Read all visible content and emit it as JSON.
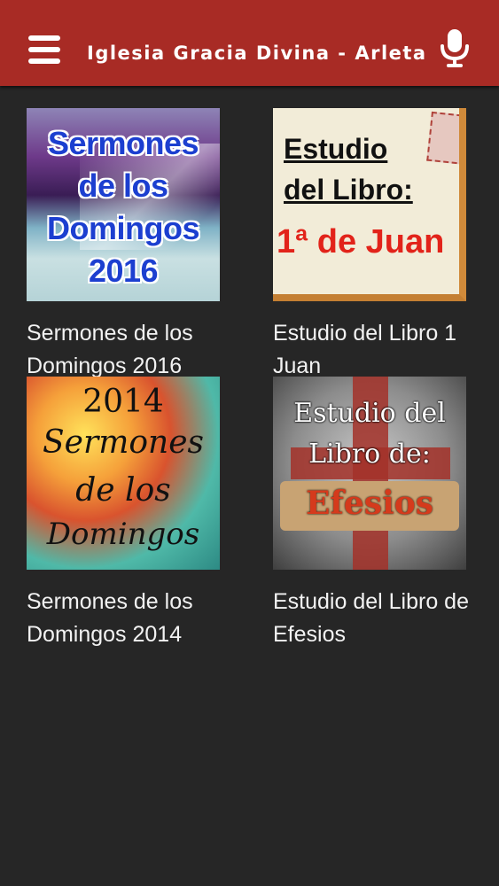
{
  "header": {
    "title": "Iglesia Gracia Divina - Arleta",
    "menu_icon": "hamburger-menu-icon",
    "mic_icon": "microphone-icon",
    "background_color": "#a82b25"
  },
  "items": [
    {
      "title": "Sermones de los Domingos 2016",
      "thumb_lines": [
        "Sermones",
        "de los",
        "Domingos",
        "2016"
      ]
    },
    {
      "title": "Estudio del Libro 1 Juan",
      "thumb_lines": [
        "Estudio",
        "del Libro:",
        "1ª de Juan"
      ]
    },
    {
      "title": "Sermones de los Domingos 2014",
      "thumb_lines": [
        "2014",
        "Sermones",
        "de los",
        "Domingos"
      ]
    },
    {
      "title": "Estudio del Libro de Efesios",
      "thumb_lines": [
        "Estudio del",
        "Libro de:",
        "Efesios"
      ]
    }
  ]
}
